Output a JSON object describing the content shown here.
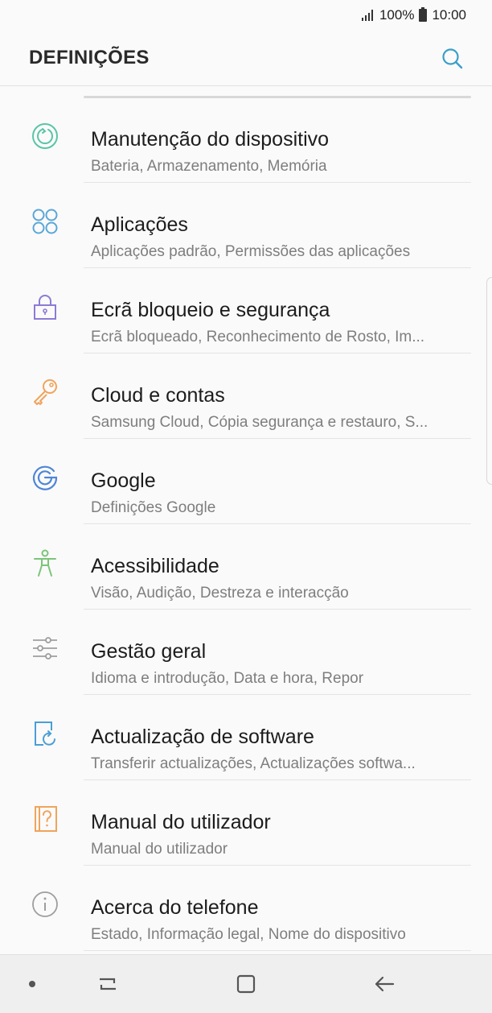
{
  "status": {
    "battery": "100%",
    "time": "10:00"
  },
  "header": {
    "title": "DEFINIÇÕES"
  },
  "items": [
    {
      "title": "Manutenção do dispositivo",
      "subtitle": "Bateria, Armazenamento, Memória",
      "icon": "device-maintenance-icon",
      "color": "#5bc4a7"
    },
    {
      "title": "Aplicações",
      "subtitle": "Aplicações padrão, Permissões das aplicações",
      "icon": "apps-icon",
      "color": "#5aa7d8"
    },
    {
      "title": "Ecrã bloqueio e segurança",
      "subtitle": "Ecrã bloqueado, Reconhecimento de Rosto, Im...",
      "icon": "lock-icon",
      "color": "#8c7bd6"
    },
    {
      "title": "Cloud e contas",
      "subtitle": "Samsung Cloud, Cópia segurança e restauro, S...",
      "icon": "key-icon",
      "color": "#f0a45c"
    },
    {
      "title": "Google",
      "subtitle": "Definições Google",
      "icon": "google-icon",
      "color": "#4f86d6"
    },
    {
      "title": "Acessibilidade",
      "subtitle": "Visão, Audição, Destreza e interacção",
      "icon": "accessibility-icon",
      "color": "#7cc47a"
    },
    {
      "title": "Gestão geral",
      "subtitle": "Idioma e introdução, Data e hora, Repor",
      "icon": "sliders-icon",
      "color": "#9e9e9e"
    },
    {
      "title": "Actualização de software",
      "subtitle": "Transferir actualizações, Actualizações softwa...",
      "icon": "software-update-icon",
      "color": "#4a9fd6"
    },
    {
      "title": "Manual do utilizador",
      "subtitle": "Manual do utilizador",
      "icon": "user-manual-icon",
      "color": "#f0a45c"
    },
    {
      "title": "Acerca do telefone",
      "subtitle": "Estado, Informação legal, Nome do dispositivo",
      "icon": "info-icon",
      "color": "#9e9e9e"
    }
  ],
  "navbar": {
    "buttons": [
      "dot-icon",
      "recent-apps-icon",
      "home-icon",
      "back-icon"
    ]
  }
}
